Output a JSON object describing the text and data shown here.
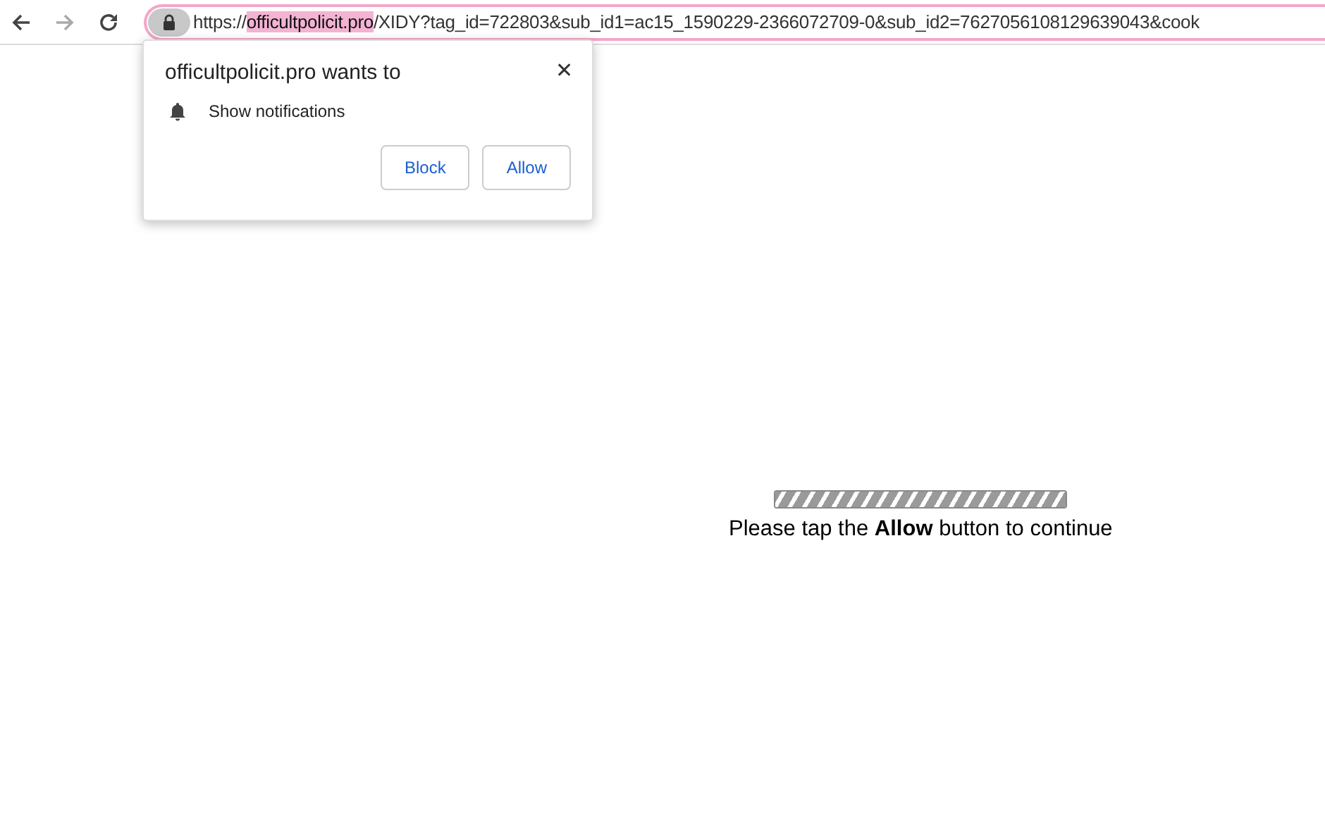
{
  "toolbar": {
    "url": {
      "scheme": "https://",
      "host": "officultpolicit.pro",
      "rest": "/XIDY?tag_id=722803&sub_id1=ac15_1590229-2366072709-0&sub_id2=7627056108129639043&cook"
    }
  },
  "permission_popup": {
    "title": "officultpolicit.pro wants to",
    "close": "✕",
    "request": "Show notifications",
    "buttons": [
      "Block",
      "Allow"
    ]
  },
  "page": {
    "progress": {
      "level": 1
    },
    "message": "Please tap the **Allow** button to continue"
  }
}
